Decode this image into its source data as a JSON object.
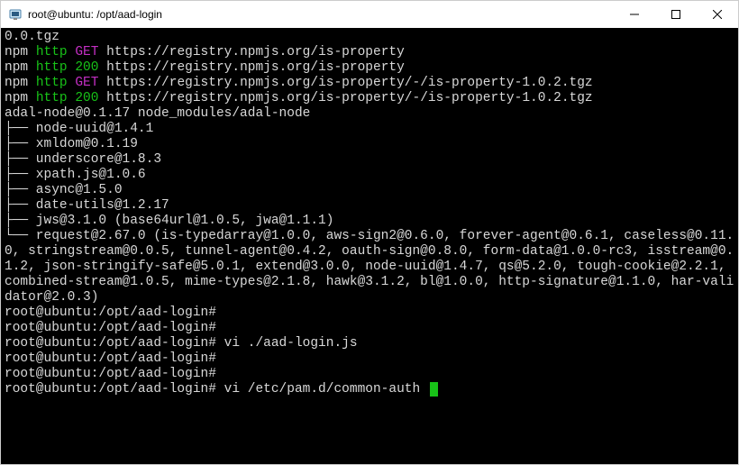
{
  "window": {
    "title": "root@ubuntu: /opt/aad-login"
  },
  "colors": {
    "bg": "#000000",
    "fg": "#d8d8d8",
    "green": "#18c218",
    "magenta": "#c42fc4",
    "titlebar_bg": "#ffffff"
  },
  "terminal": {
    "lines": [
      [
        {
          "t": "0.0.tgz",
          "c": "white"
        }
      ],
      [
        {
          "t": "npm ",
          "c": "white"
        },
        {
          "t": "http ",
          "c": "green"
        },
        {
          "t": "GET ",
          "c": "magenta"
        },
        {
          "t": "https://registry.npmjs.org/is-property",
          "c": "white"
        }
      ],
      [
        {
          "t": "npm ",
          "c": "white"
        },
        {
          "t": "http ",
          "c": "green"
        },
        {
          "t": "200 ",
          "c": "green"
        },
        {
          "t": "https://registry.npmjs.org/is-property",
          "c": "white"
        }
      ],
      [
        {
          "t": "npm ",
          "c": "white"
        },
        {
          "t": "http ",
          "c": "green"
        },
        {
          "t": "GET ",
          "c": "magenta"
        },
        {
          "t": "https://registry.npmjs.org/is-property/-/is-property-1.0.2.tgz",
          "c": "white"
        }
      ],
      [
        {
          "t": "npm ",
          "c": "white"
        },
        {
          "t": "http ",
          "c": "green"
        },
        {
          "t": "200 ",
          "c": "green"
        },
        {
          "t": "https://registry.npmjs.org/is-property/-/is-property-1.0.2.tgz",
          "c": "white"
        }
      ],
      [
        {
          "t": "adal-node@0.1.17 node_modules/adal-node",
          "c": "white"
        }
      ],
      [
        {
          "t": "├── node-uuid@1.4.1",
          "c": "white"
        }
      ],
      [
        {
          "t": "├── xmldom@0.1.19",
          "c": "white"
        }
      ],
      [
        {
          "t": "├── underscore@1.8.3",
          "c": "white"
        }
      ],
      [
        {
          "t": "├── xpath.js@1.0.6",
          "c": "white"
        }
      ],
      [
        {
          "t": "├── async@1.5.0",
          "c": "white"
        }
      ],
      [
        {
          "t": "├── date-utils@1.2.17",
          "c": "white"
        }
      ],
      [
        {
          "t": "├── jws@3.1.0 (base64url@1.0.5, jwa@1.1.1)",
          "c": "white"
        }
      ],
      [
        {
          "t": "└── request@2.67.0 (is-typedarray@1.0.0, aws-sign2@0.6.0, forever-agent@0.6.1, caseless@0.11.0, stringstream@0.0.5, tunnel-agent@0.4.2, oauth-sign@0.8.0, form-data@1.0.0-rc3, isstream@0.1.2, json-stringify-safe@5.0.1, extend@3.0.0, node-uuid@1.4.7, qs@5.2.0, tough-cookie@2.2.1, combined-stream@1.0.5, mime-types@2.1.8, hawk@3.1.2, bl@1.0.0, http-signature@1.1.0, har-validator@2.0.3)",
          "c": "white"
        }
      ],
      [
        {
          "t": "root@ubuntu:/opt/aad-login#",
          "c": "white"
        }
      ],
      [
        {
          "t": "root@ubuntu:/opt/aad-login#",
          "c": "white"
        }
      ],
      [
        {
          "t": "root@ubuntu:/opt/aad-login# vi ./aad-login.js",
          "c": "white"
        }
      ],
      [
        {
          "t": "root@ubuntu:/opt/aad-login#",
          "c": "white"
        }
      ],
      [
        {
          "t": "root@ubuntu:/opt/aad-login#",
          "c": "white"
        }
      ],
      [
        {
          "t": "root@ubuntu:/opt/aad-login# vi /etc/pam.d/common-auth ",
          "c": "white",
          "cursor": true
        }
      ]
    ]
  }
}
